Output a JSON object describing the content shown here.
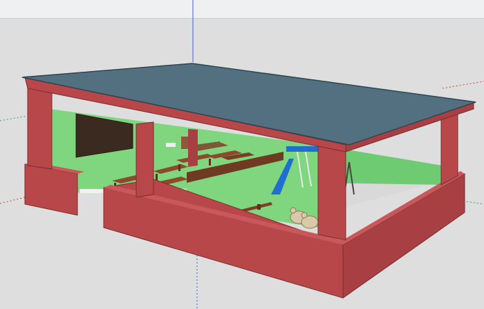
{
  "viewport": {
    "background": "#dedede",
    "sky_strip": "#eef0f2"
  },
  "colors": {
    "roof": "#52707f",
    "roof_edge": "#2e4450",
    "wall_red": "#b8474a",
    "wall_red_dark": "#8f3336",
    "wall_red_light": "#c9585a",
    "interior_green": "#7fd67f",
    "interior_green_dark": "#5fbf62",
    "chalkboard": "#3b2a20",
    "floor": "#d9d9d9",
    "desk_wood": "#8b4a2b",
    "desk_wood_dark": "#5e2f1a",
    "slide_blue": "#1f6fd0",
    "rocking_horse": "#d8c9a8",
    "axis_green": "#2fa84f",
    "axis_red": "#d03a3a",
    "axis_blue": "#3a5fd0"
  },
  "icons": {
    "axis": "model-axes",
    "building": "classroom-model",
    "slide": "playground-slide",
    "swing": "swing-set",
    "horse": "rocking-horse",
    "seesaw": "seesaw"
  }
}
